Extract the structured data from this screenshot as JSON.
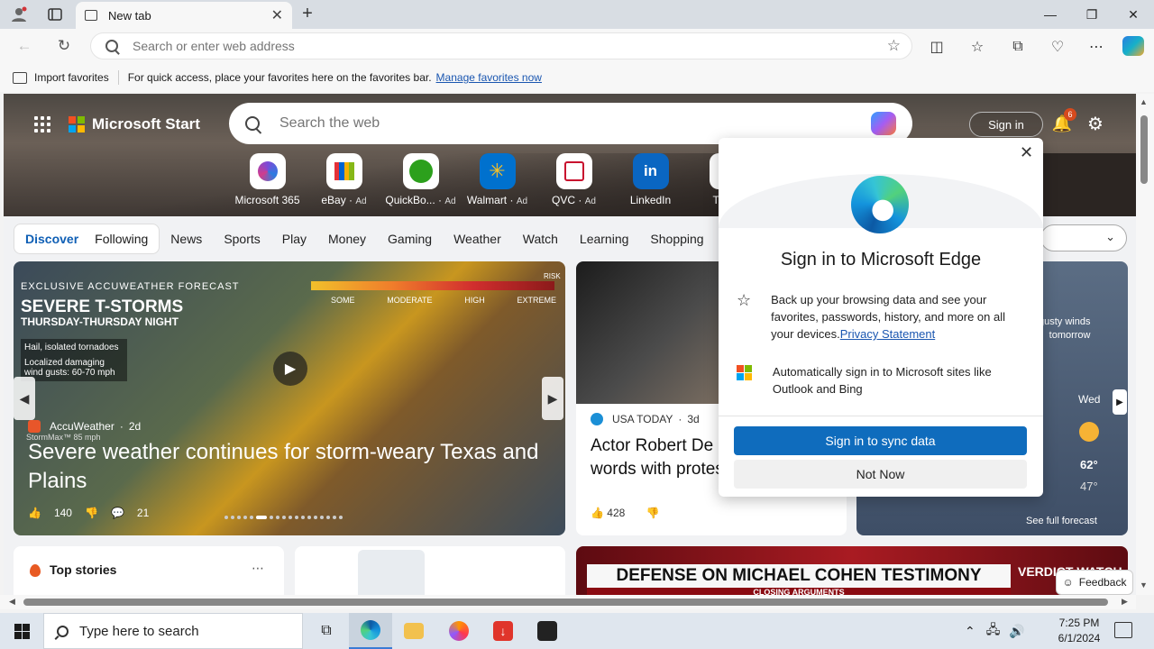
{
  "browser": {
    "tab_title": "New tab",
    "address_placeholder": "Search or enter web address"
  },
  "favorites_bar": {
    "import_label": "Import favorites",
    "message": "For quick access, place your favorites here on the favorites bar.",
    "manage_link": "Manage favorites now"
  },
  "msn": {
    "brand": "Microsoft Start",
    "search_placeholder": "Search the web",
    "signin_label": "Sign in",
    "notification_count": "6",
    "quick_links": [
      {
        "label": "Microsoft 365",
        "ad": ""
      },
      {
        "label": "eBay",
        "ad": "Ad"
      },
      {
        "label": "QuickBo...",
        "ad": "Ad"
      },
      {
        "label": "Walmart",
        "ad": "Ad"
      },
      {
        "label": "QVC",
        "ad": "Ad"
      },
      {
        "label": "LinkedIn",
        "ad": ""
      },
      {
        "label": "Takeb",
        "ad": ""
      }
    ],
    "feed_pills": [
      "Discover",
      "Following"
    ],
    "nav_items": [
      "News",
      "Sports",
      "Play",
      "Money",
      "Gaming",
      "Weather",
      "Watch",
      "Learning",
      "Shopping"
    ]
  },
  "main_card": {
    "overlay_header": "EXCLUSIVE ACCUWEATHER FORECAST",
    "overlay_title": "SEVERE T-STORMS",
    "overlay_subtitle": "THURSDAY-THURSDAY NIGHT",
    "risk_label": "RISK",
    "risk_levels": [
      "SOME",
      "MODERATE",
      "HIGH",
      "EXTREME"
    ],
    "legend_1": "Hail, isolated tornadoes",
    "legend_2": "Localized damaging wind gusts: 60-70 mph",
    "legend_3": "StormMax™ 85 mph",
    "source": "AccuWeather",
    "age": "2d",
    "headline": "Severe weather continues for storm-weary Texas and Plains",
    "likes": "140",
    "comments": "21"
  },
  "news_card": {
    "source": "USA TODAY",
    "age": "3d",
    "headline": "Actor Robert De Niro exchanges words with protester after speech",
    "likes": "428"
  },
  "weather_card": {
    "wind_note_1": "gusty winds",
    "wind_note_2": "tomorrow",
    "day": "Wed",
    "high": "62°",
    "low": "47°",
    "forecast_link": "See full forecast"
  },
  "lower": {
    "top_stories": "Top stories",
    "cohen_banner": "DEFENSE ON MICHAEL COHEN TESTIMONY",
    "cohen_sub": "CLOSING ARGUMENTS",
    "verdict": "VERDICT WATCH",
    "feedback": "Feedback"
  },
  "popup": {
    "title": "Sign in to Microsoft Edge",
    "row1_text": "Back up your browsing data and see your favorites, passwords, history, and more on all your devices.",
    "privacy_link": "Privacy Statement",
    "row2_text": "Automatically sign in to Microsoft sites like Outlook and Bing",
    "primary_button": "Sign in to sync data",
    "secondary_button": "Not Now"
  },
  "taskbar": {
    "search_placeholder": "Type here to search",
    "time": "7:25 PM",
    "date": "6/1/2024"
  },
  "colors": {
    "accent": "#0f6cbd",
    "ms_red": "#f25022",
    "ms_green": "#7fba00",
    "ms_blue": "#00a4ef",
    "ms_yellow": "#ffb900"
  }
}
